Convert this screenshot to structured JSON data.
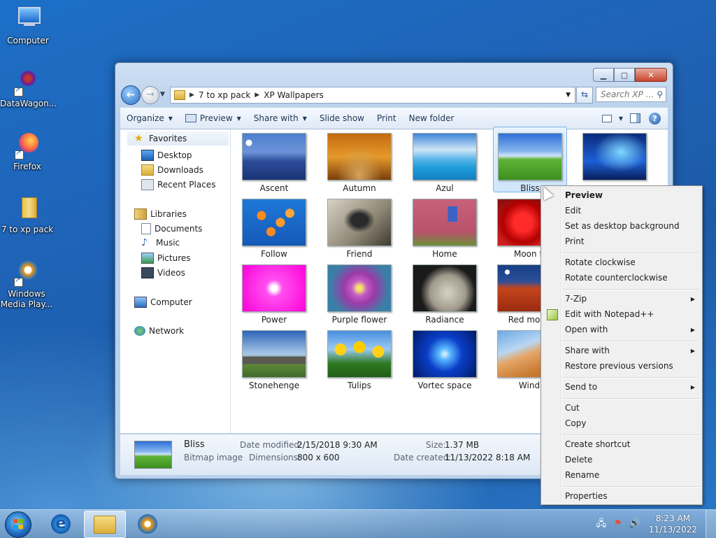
{
  "desktop": {
    "icons": [
      {
        "label": "Computer"
      },
      {
        "label": "DataWagon..."
      },
      {
        "label": "Firefox"
      },
      {
        "label": "7 to xp pack"
      },
      {
        "label": "Windows Media Play..."
      }
    ]
  },
  "window": {
    "address": {
      "crumbs": [
        "7 to xp pack",
        "XP Wallpapers"
      ]
    },
    "search_placeholder": "Search XP ...",
    "toolbar": {
      "organize": "Organize",
      "preview": "Preview",
      "share_with": "Share with",
      "slide_show": "Slide show",
      "print": "Print",
      "new_folder": "New folder"
    },
    "nav": {
      "favorites": "Favorites",
      "desktop": "Desktop",
      "downloads": "Downloads",
      "recent_places": "Recent Places",
      "libraries": "Libraries",
      "documents": "Documents",
      "music": "Music",
      "pictures": "Pictures",
      "videos": "Videos",
      "computer": "Computer",
      "network": "Network"
    },
    "files": [
      {
        "name": "Ascent"
      },
      {
        "name": "Autumn"
      },
      {
        "name": "Azul"
      },
      {
        "name": "Bliss"
      },
      {
        "name": ""
      },
      {
        "name": "Follow"
      },
      {
        "name": "Friend"
      },
      {
        "name": "Home"
      },
      {
        "name": "Moon fl"
      },
      {
        "name": "Power"
      },
      {
        "name": "Purple flower"
      },
      {
        "name": "Radiance"
      },
      {
        "name": "Red moon"
      },
      {
        "name": "Stonehenge"
      },
      {
        "name": "Tulips"
      },
      {
        "name": "Vortec space"
      },
      {
        "name": "Wind"
      }
    ],
    "details": {
      "name": "Bliss",
      "type": "Bitmap image",
      "date_modified_label": "Date modified:",
      "date_modified": "2/15/2018 9:30 AM",
      "dimensions_label": "Dimensions:",
      "dimensions": "800 x 600",
      "size_label": "Size:",
      "size": "1.37 MB",
      "date_created_label": "Date created:",
      "date_created": "11/13/2022 8:18 AM"
    }
  },
  "context_menu": {
    "preview": "Preview",
    "edit": "Edit",
    "set_bg": "Set as desktop background",
    "print": "Print",
    "rotate_cw": "Rotate clockwise",
    "rotate_ccw": "Rotate counterclockwise",
    "seven_zip": "7-Zip",
    "notepad": "Edit with Notepad++",
    "open_with": "Open with",
    "share_with": "Share with",
    "restore": "Restore previous versions",
    "send_to": "Send to",
    "cut": "Cut",
    "copy": "Copy",
    "create_shortcut": "Create shortcut",
    "delete": "Delete",
    "rename": "Rename",
    "properties": "Properties"
  },
  "taskbar": {
    "time": "8:23 AM",
    "date": "11/13/2022"
  },
  "colors": {
    "selection": "#cfe5fb",
    "accent": "#1f63b6"
  }
}
